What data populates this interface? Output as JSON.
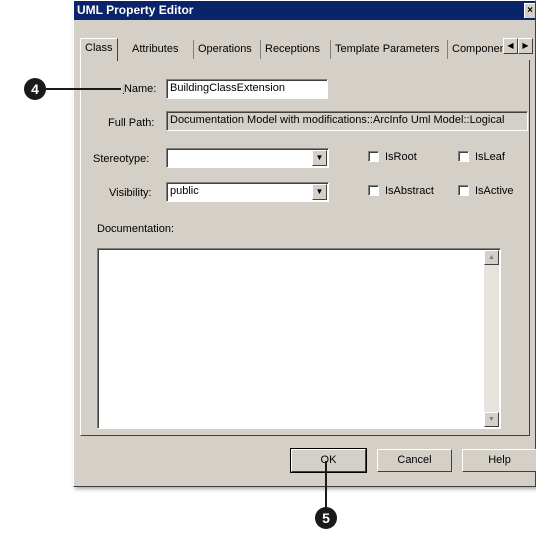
{
  "dialog": {
    "title": "UML Property Editor",
    "close_glyph": "×"
  },
  "tabs": [
    {
      "label": "Class",
      "active": true
    },
    {
      "label": "Attributes",
      "active": false
    },
    {
      "label": "Operations",
      "active": false
    },
    {
      "label": "Receptions",
      "active": false
    },
    {
      "label": "Template Parameters",
      "active": false
    },
    {
      "label": "Componen",
      "active": false
    }
  ],
  "form": {
    "name_label": "Name:",
    "name_value": "BuildingClassExtension",
    "fullpath_label": "Full Path:",
    "fullpath_value": "Documentation Model with modifications::ArcInfo Uml Model::Logical",
    "stereotype_label": "Stereotype:",
    "stereotype_value": "",
    "visibility_label": "Visibility:",
    "visibility_value": "public",
    "isroot_label": "IsRoot",
    "isleaf_label": "IsLeaf",
    "isabstract_label": "IsAbstract",
    "isactive_label": "IsActive",
    "documentation_label": "Documentation:",
    "documentation_value": ""
  },
  "buttons": {
    "ok": "OK",
    "cancel": "Cancel",
    "help": "Help"
  },
  "callouts": {
    "step4": "4",
    "step5": "5"
  },
  "colors": {
    "title_bar": "#0a246a",
    "dialog_face": "#d4d0c8",
    "callout": "#1a1a1a"
  }
}
